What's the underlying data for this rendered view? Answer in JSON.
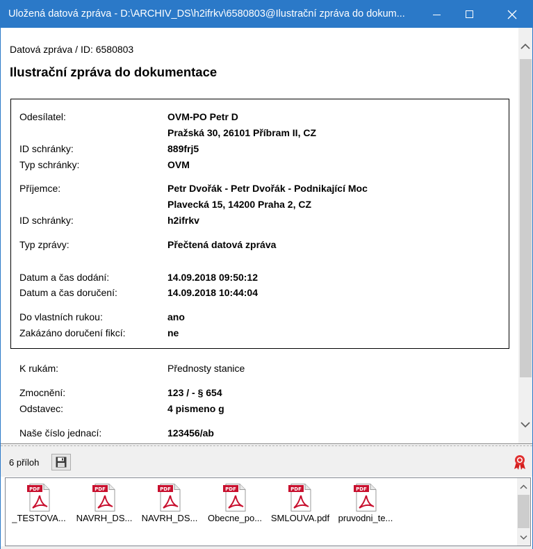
{
  "window": {
    "title": "Uložená datová zpráva - D:\\ARCHIV_DS\\h2ifrkv\\6580803@Ilustrační zpráva do dokum...",
    "accent_color": "#2b79c8",
    "minimize_icon": "minimize-icon",
    "maximize_icon": "maximize-icon",
    "close_icon": "close-icon"
  },
  "message": {
    "breadcrumb": "Datová zpráva / ID: 6580803",
    "title": "Ilustrační zpráva do dokumentace"
  },
  "details": {
    "sender_label": "Odesílatel:",
    "sender_name": "OVM-PO Petr D",
    "sender_address": "Pražská 30, 26101 Příbram II, CZ",
    "sender_box_id_label": "ID schránky:",
    "sender_box_id": "889frj5",
    "sender_box_type_label": "Typ schránky:",
    "sender_box_type": "OVM",
    "recipient_label": "Příjemce:",
    "recipient_name": "Petr Dvořák - Petr Dvořák - Podnikající Moc",
    "recipient_address": "Plavecká 15, 14200 Praha 2, CZ",
    "recipient_box_id_label": "ID schránky:",
    "recipient_box_id": "h2ifrkv",
    "message_type_label": "Typ zprávy:",
    "message_type": "Přečtená datová zpráva",
    "delivered_label": "Datum a čas dodání:",
    "delivered": "14.09.2018 09:50:12",
    "accepted_label": "Datum a čas doručení:",
    "accepted": "14.09.2018 10:44:04",
    "personal_label": "Do vlastních rukou:",
    "personal": "ano",
    "fiction_label": "Zakázáno doručení fikcí:",
    "fiction": "ne"
  },
  "extra": {
    "to_hands_label": "K rukám:",
    "to_hands": "Přednosty stanice",
    "authorization_label": "Zmocnění:",
    "authorization": "123 / - § 654",
    "paragraph_label": "Odstavec:",
    "paragraph": "4 pismeno g",
    "our_ref_label": "Naše číslo jednací:",
    "our_ref": "123456/ab"
  },
  "attachments": {
    "count_label": "6 příloh",
    "save_icon": "save-icon",
    "award_icon": "award-icon",
    "files": [
      {
        "name": "_TESTOVA...",
        "icon": "pdf-icon"
      },
      {
        "name": "NAVRH_DS...",
        "icon": "pdf-icon"
      },
      {
        "name": "NAVRH_DS...",
        "icon": "pdf-icon"
      },
      {
        "name": "Obecne_po...",
        "icon": "pdf-icon"
      },
      {
        "name": "SMLOUVA.pdf",
        "icon": "pdf-icon"
      },
      {
        "name": "pruvodni_te...",
        "icon": "pdf-icon"
      }
    ],
    "pdf_badge": "PDF"
  }
}
